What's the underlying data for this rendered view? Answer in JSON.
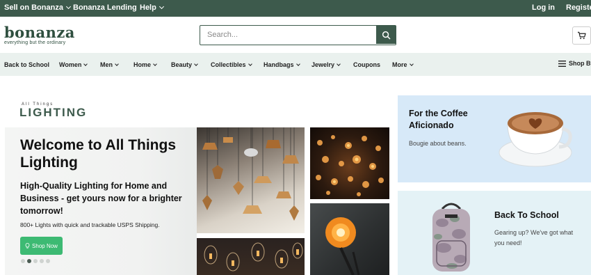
{
  "topbar": {
    "sell": "Sell on Bonanza",
    "lending": "Bonanza Lending",
    "help": "Help",
    "login": "Log in",
    "register": "Register"
  },
  "header": {
    "logo_word": "bonanza",
    "logo_tagline": "everything but the ordinary",
    "search_placeholder": "Search..."
  },
  "nav": {
    "items": [
      "Back to School",
      "Women",
      "Men",
      "Home",
      "Beauty",
      "Collectibles",
      "Handbags",
      "Jewelry",
      "Coupons",
      "More"
    ],
    "shop_by": "Shop By"
  },
  "hero": {
    "brand_tiny": "All Things",
    "brand_big": "LIGHTING",
    "title": "Welcome to All Things Lighting",
    "subtitle": "High-Quality Lighting for Home and Business - get yours now for a brighter tomorrow!",
    "small": "800+ Lights with quick and trackable USPS Shipping.",
    "shop_now": "Shop Now",
    "carousel": {
      "count": 5,
      "active": 2
    }
  },
  "promos": [
    {
      "title": "For the Coffee Aficionado",
      "text": "Bougie about beans."
    },
    {
      "title": "Back To School",
      "text": "Gearing up? We've got what you need!"
    }
  ],
  "colors": {
    "brand_green": "#3d5a4c",
    "nav_bg": "#eaf1ee",
    "cta_green": "#3dba73",
    "coffee_card": "#d7e9f8",
    "school_card": "#e4f2f6"
  }
}
